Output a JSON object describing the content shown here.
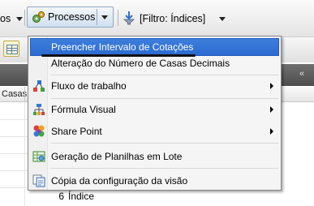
{
  "toolbar": {
    "left_partial": "os",
    "processos_label": "Processos",
    "filtro_label": "[Filtro: Índices]"
  },
  "column_header": {
    "label": "Casas"
  },
  "grid_row": {
    "number": "6",
    "text": "Índice"
  },
  "menu": {
    "items": [
      {
        "label": "Preencher Intervalo de Cotações",
        "icon": "none",
        "submenu": false,
        "highlighted": true
      },
      {
        "label": "Alteração do Número de Casas Decimais",
        "icon": "none",
        "submenu": false,
        "highlighted": false
      },
      {
        "label": "Fluxo de trabalho",
        "icon": "workflow-icon",
        "submenu": true,
        "highlighted": false
      },
      {
        "label": "Fórmula Visual",
        "icon": "formula-tree-icon",
        "submenu": true,
        "highlighted": false
      },
      {
        "label": "Share Point",
        "icon": "sharepoint-icon",
        "submenu": true,
        "highlighted": false
      },
      {
        "label": "Geração de Planilhas em Lote",
        "icon": "spreadsheet-batch-icon",
        "submenu": false,
        "highlighted": false
      },
      {
        "label": "Cópia da configuração da visão",
        "icon": "copy-view-icon",
        "submenu": false,
        "highlighted": false
      }
    ]
  },
  "colors": {
    "highlight": "#2f6fd4",
    "menu_bg": "#f5f5f5",
    "dark_band": "#5a5a5a"
  }
}
